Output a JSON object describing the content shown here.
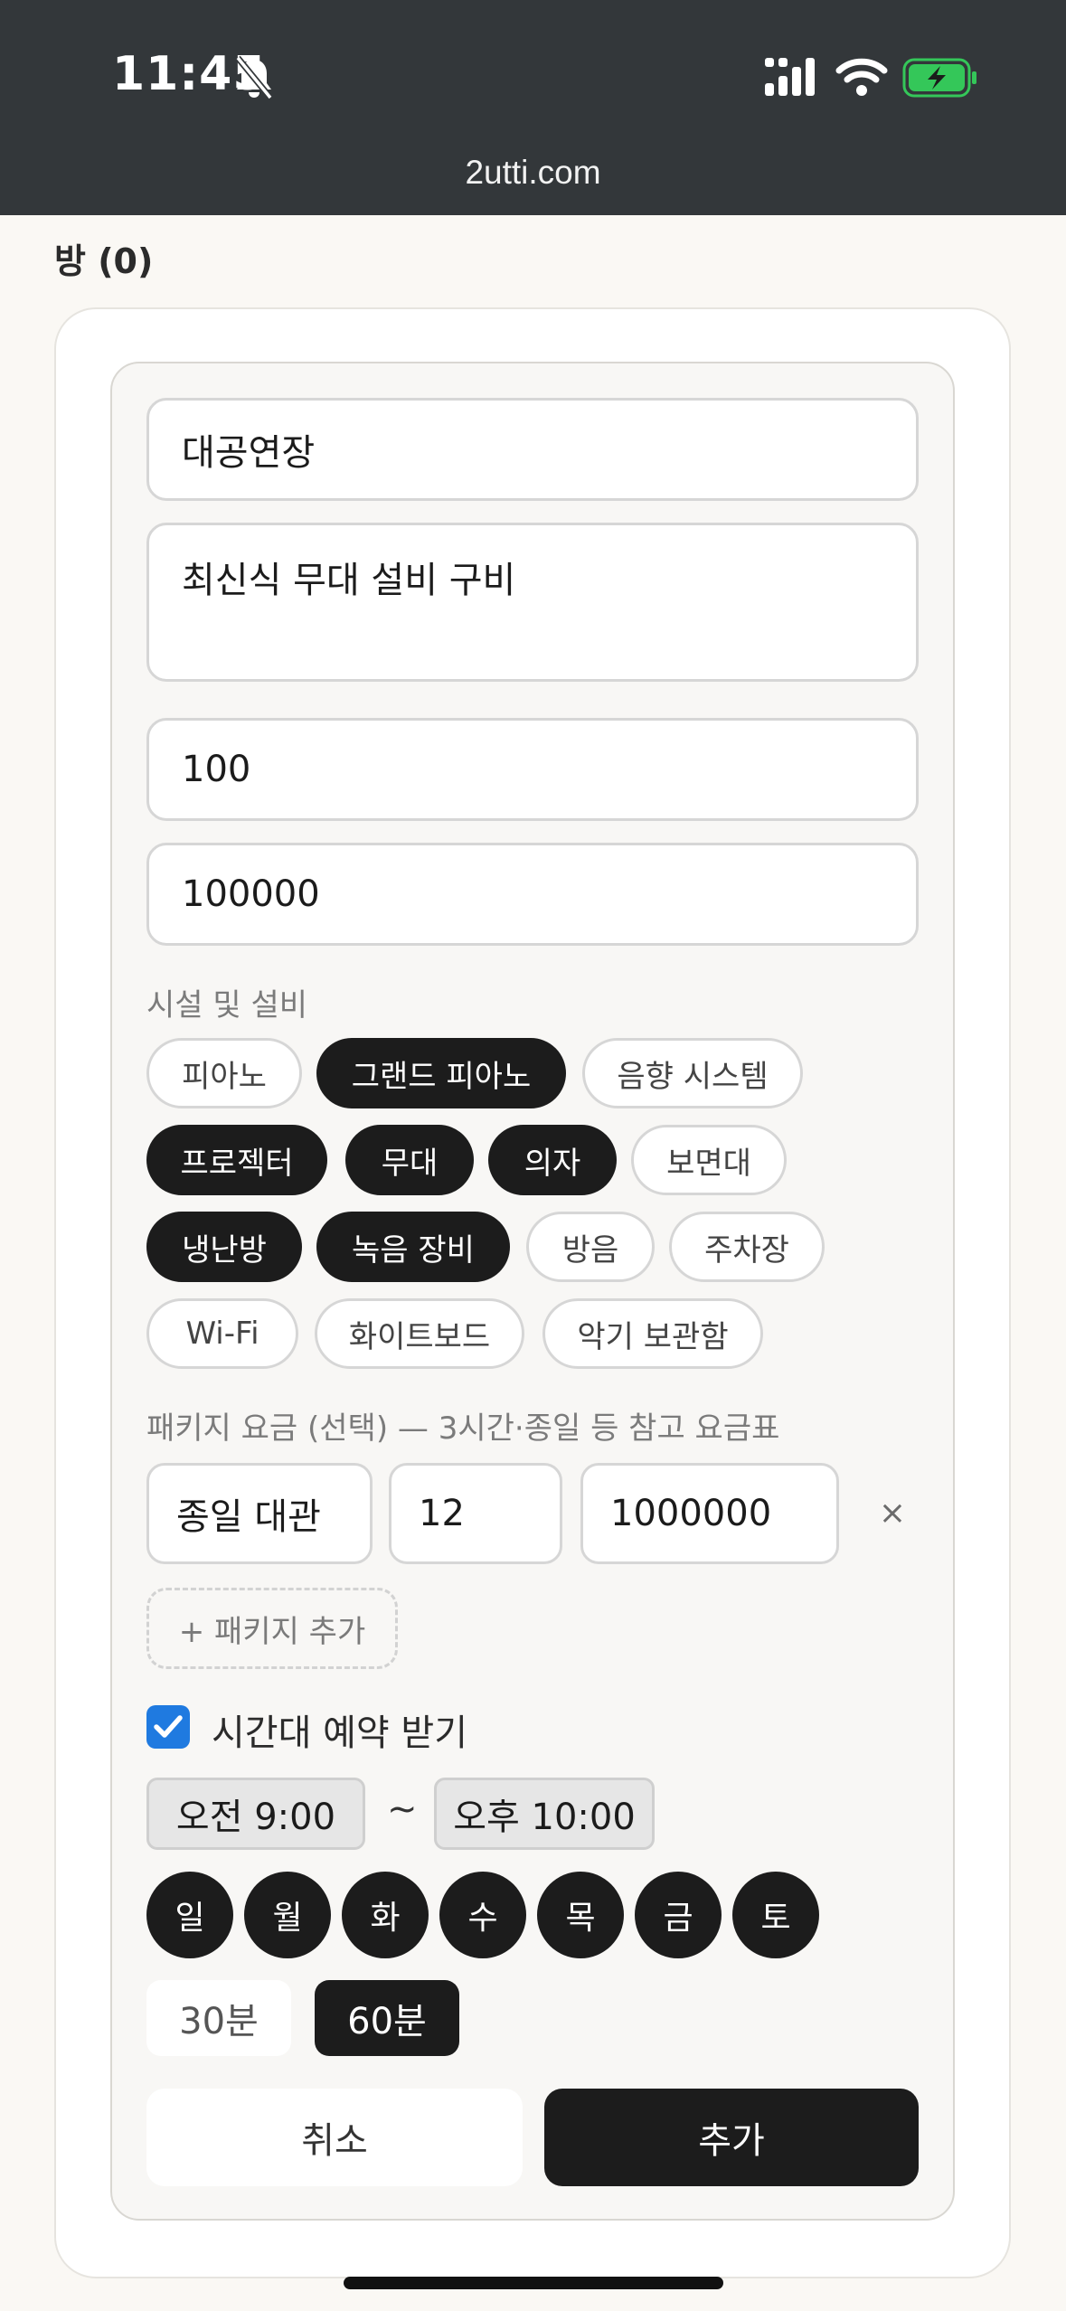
{
  "status": {
    "time": "11:45"
  },
  "browser": {
    "url": "2utti.com"
  },
  "section_title": "방 (0)",
  "form": {
    "name_value": "대공연장",
    "description_value": "최신식 무대 설비 구비",
    "capacity_value": "100",
    "price_value": "100000",
    "facilities_label": "시설 및 설비",
    "facilities": [
      {
        "label": "피아노",
        "selected": false
      },
      {
        "label": "그랜드 피아노",
        "selected": true
      },
      {
        "label": "음향 시스템",
        "selected": false
      },
      {
        "label": "프로젝터",
        "selected": true
      },
      {
        "label": "무대",
        "selected": true
      },
      {
        "label": "의자",
        "selected": true
      },
      {
        "label": "보면대",
        "selected": false
      },
      {
        "label": "냉난방",
        "selected": true
      },
      {
        "label": "녹음 장비",
        "selected": true
      },
      {
        "label": "방음",
        "selected": false
      },
      {
        "label": "주차장",
        "selected": false
      },
      {
        "label": "Wi-Fi",
        "selected": false
      },
      {
        "label": "화이트보드",
        "selected": false
      },
      {
        "label": "악기 보관함",
        "selected": false
      }
    ],
    "package_label": "패키지 요금 (선택) — 3시간·종일 등 참고 요금표",
    "package": {
      "name": "종일 대관",
      "hours": "12",
      "price": "1000000",
      "remove_glyph": "×"
    },
    "add_package_label": "+ 패키지 추가",
    "time_slot_label": "시간대 예약 받기",
    "time_slot_checked": true,
    "start_time": "오전 9:00",
    "range_separator": "~",
    "end_time": "오후 10:00",
    "days": [
      "일",
      "월",
      "화",
      "수",
      "목",
      "금",
      "토"
    ],
    "durations": [
      {
        "label": "30분",
        "selected": false
      },
      {
        "label": "60분",
        "selected": true
      }
    ],
    "cancel_label": "취소",
    "submit_label": "추가"
  },
  "colors": {
    "status_bar": "#33373a",
    "accent_dark": "#1c1c1c",
    "checkbox_blue": "#1f7ae0",
    "battery_green": "#34c759"
  }
}
